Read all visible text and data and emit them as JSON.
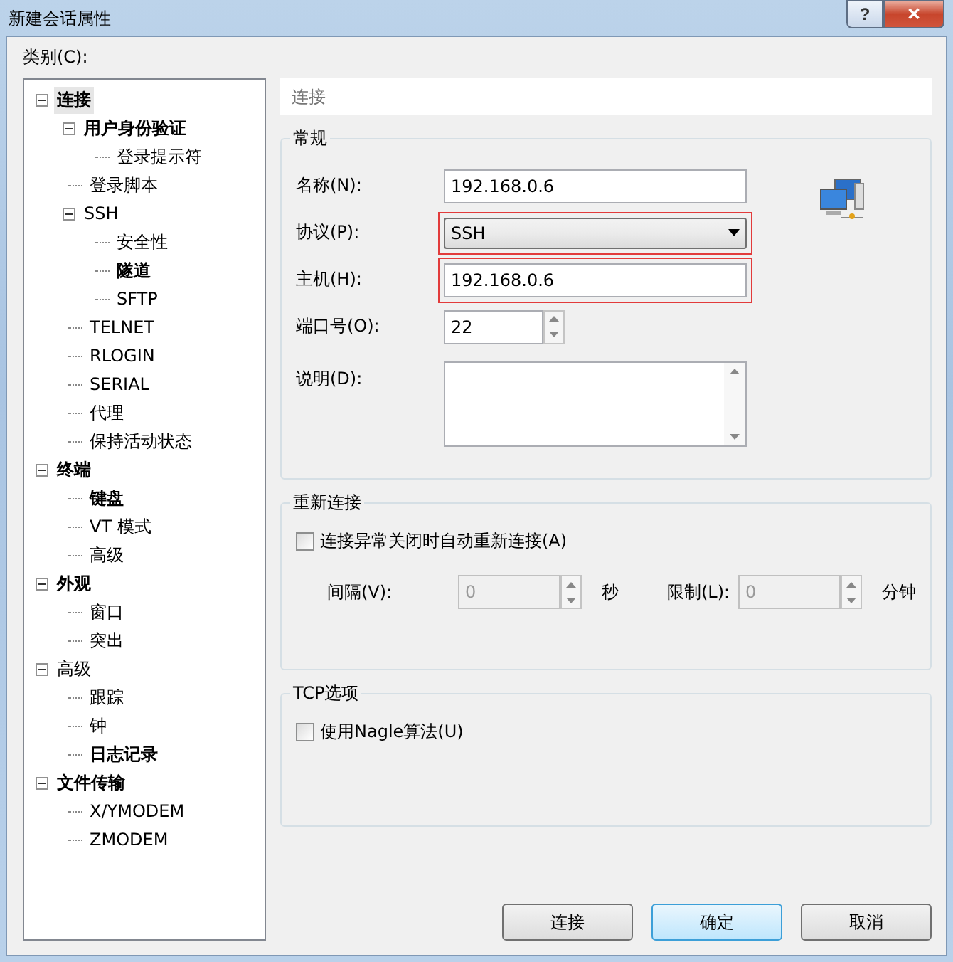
{
  "window": {
    "title": "新建会话属性",
    "help": "?",
    "close": "✕"
  },
  "category_label": "类别(C):",
  "tree": [
    {
      "label": "连接",
      "bold": true,
      "selected": true,
      "expanded": true,
      "children": [
        {
          "label": "用户身份验证",
          "bold": true,
          "selected": false,
          "expanded": true,
          "children": [
            {
              "label": "登录提示符",
              "bold": false,
              "selected": false
            }
          ]
        },
        {
          "label": "登录脚本",
          "bold": false,
          "selected": false
        },
        {
          "label": "SSH",
          "bold": false,
          "selected": false,
          "expanded": true,
          "children": [
            {
              "label": "安全性",
              "bold": false,
              "selected": false
            },
            {
              "label": "隧道",
              "bold": true,
              "selected": false
            },
            {
              "label": "SFTP",
              "bold": false,
              "selected": false
            }
          ]
        },
        {
          "label": "TELNET",
          "bold": false,
          "selected": false
        },
        {
          "label": "RLOGIN",
          "bold": false,
          "selected": false
        },
        {
          "label": "SERIAL",
          "bold": false,
          "selected": false
        },
        {
          "label": "代理",
          "bold": false,
          "selected": false
        },
        {
          "label": "保持活动状态",
          "bold": false,
          "selected": false
        }
      ]
    },
    {
      "label": "终端",
      "bold": true,
      "selected": false,
      "expanded": true,
      "children": [
        {
          "label": "键盘",
          "bold": true,
          "selected": false
        },
        {
          "label": "VT 模式",
          "bold": false,
          "selected": false
        },
        {
          "label": "高级",
          "bold": false,
          "selected": false
        }
      ]
    },
    {
      "label": "外观",
      "bold": true,
      "selected": false,
      "expanded": true,
      "children": [
        {
          "label": "窗口",
          "bold": false,
          "selected": false
        },
        {
          "label": "突出",
          "bold": false,
          "selected": false
        }
      ]
    },
    {
      "label": "高级",
      "bold": false,
      "selected": false,
      "expanded": true,
      "children": [
        {
          "label": "跟踪",
          "bold": false,
          "selected": false
        },
        {
          "label": "钟",
          "bold": false,
          "selected": false
        },
        {
          "label": "日志记录",
          "bold": true,
          "selected": false
        }
      ]
    },
    {
      "label": "文件传输",
      "bold": true,
      "selected": false,
      "expanded": true,
      "children": [
        {
          "label": "X/YMODEM",
          "bold": false,
          "selected": false
        },
        {
          "label": "ZMODEM",
          "bold": false,
          "selected": false
        }
      ]
    }
  ],
  "page_header": "连接",
  "general": {
    "title": "常规",
    "name": {
      "label": "名称(N):",
      "value": "192.168.0.6",
      "highlighted": false
    },
    "protocol": {
      "label": "协议(P):",
      "value": "SSH",
      "highlighted": true
    },
    "host": {
      "label": "主机(H):",
      "value": "192.168.0.6",
      "highlighted": true
    },
    "port": {
      "label": "端口号(O):",
      "value": "22"
    },
    "description": {
      "label": "说明(D):"
    }
  },
  "reconnect": {
    "title": "重新连接",
    "auto": {
      "label": "连接异常关闭时自动重新连接(A)",
      "checked": false
    },
    "interval": {
      "label": "间隔(V):",
      "value": "0",
      "unit": "秒",
      "disabled": true
    },
    "limit": {
      "label": "限制(L):",
      "value": "0",
      "unit": "分钟",
      "disabled": true
    }
  },
  "tcp": {
    "title": "TCP选项",
    "nagle": {
      "label": "使用Nagle算法(U)",
      "checked": false
    }
  },
  "buttons": [
    {
      "label": "连接",
      "default": false
    },
    {
      "label": "确定",
      "default": true
    },
    {
      "label": "取消",
      "default": false
    }
  ]
}
